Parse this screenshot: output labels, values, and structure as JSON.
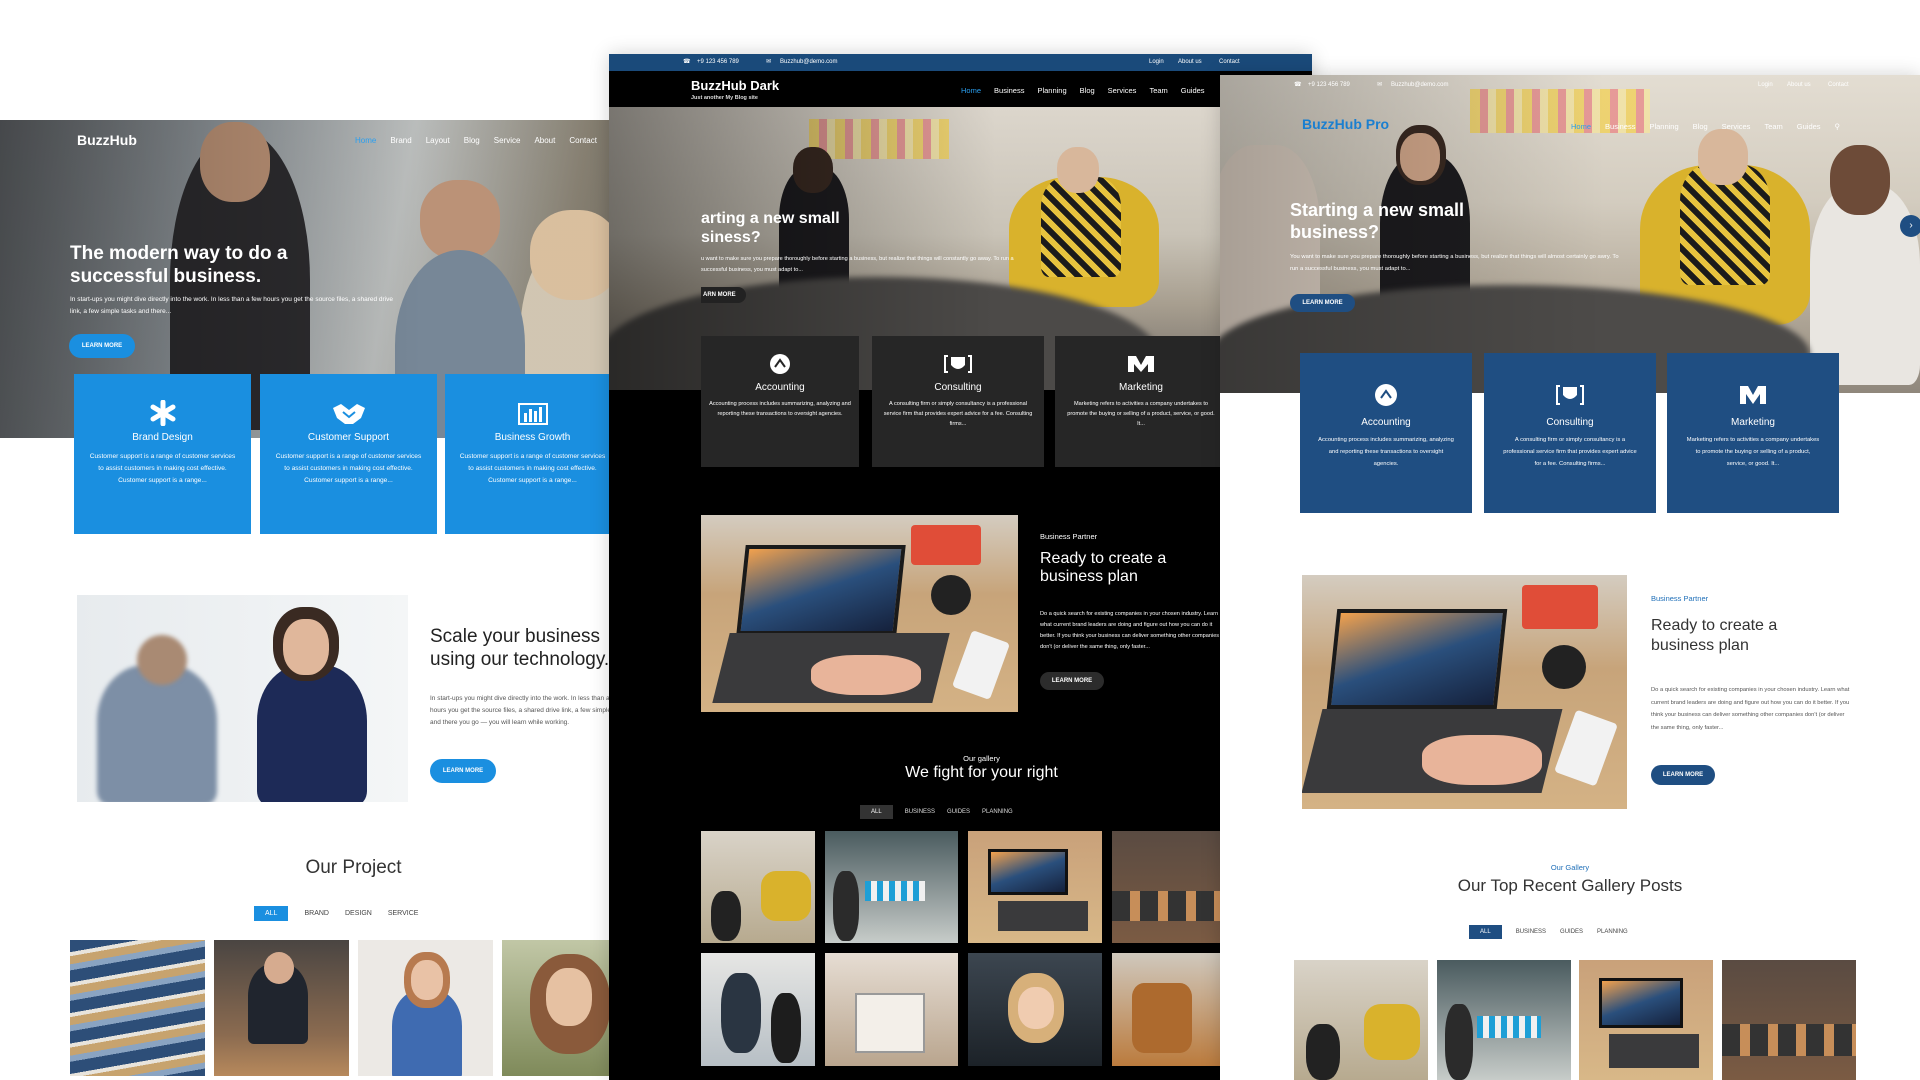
{
  "light": {
    "brand": "BuzzHub",
    "nav": [
      "Home",
      "Brand",
      "Layout",
      "Blog",
      "Service",
      "About",
      "Contact"
    ],
    "hero_title": "The modern way to do a successful business.",
    "hero_text": "In start-ups you might dive directly into the work. In less than a few hours you get the source files, a shared drive link, a few simple tasks and there...",
    "hero_button": "LEARN MORE",
    "cards": [
      {
        "title": "Brand Design",
        "text": "Customer support is a range of customer services to assist customers in making cost effective. Customer support is a range...",
        "icon": "asterisk-icon"
      },
      {
        "title": "Customer Support",
        "text": "Customer support is a range of customer services to assist customers in making cost effective. Customer support is a range...",
        "icon": "handshake-icon"
      },
      {
        "title": "Business Growth",
        "text": "Customer support is a range of customer services to assist customers in making cost effective. Customer support is a range...",
        "icon": "bar-chart-icon"
      }
    ],
    "about_title": "Scale your business using our technology.",
    "about_text": "In start-ups you might dive directly into the work. In less than a few hours you get the source files, a shared drive link, a few simple tasks and there you go — you will learn while working.",
    "about_button": "LEARN MORE",
    "project_title": "Our Project",
    "filters": [
      "ALL",
      "BRAND",
      "DESIGN",
      "SERVICE"
    ]
  },
  "dark": {
    "phone": "+9 123 456 789",
    "email": "Buzzhub@demo.com",
    "top_links": [
      "Login",
      "About us",
      "Contact"
    ],
    "brand": "BuzzHub Dark",
    "tagline": "Just another My Blog site",
    "nav": [
      "Home",
      "Business",
      "Planning",
      "Blog",
      "Services",
      "Team",
      "Guides"
    ],
    "hero_title": "arting a new small siness?",
    "hero_text": "u want to make sure you prepare thoroughly before starting a business, but realize that things will constantly go away. To run a successful business, you must adapt to...",
    "hero_button": "ARN MORE",
    "cards": [
      {
        "title": "Accounting",
        "text": "Accounting process includes summarizing, analyzing and reporting these transactions to oversight agencies.",
        "icon": "accounting-icon"
      },
      {
        "title": "Consulting",
        "text": "A consulting firm or simply consultancy is a professional service firm that provides expert advice for a fee. Consulting firms...",
        "icon": "consulting-icon"
      },
      {
        "title": "Marketing",
        "text": "Marketing refers to activities a company undertakes to promote the buying or selling of a product, service, or good. It...",
        "icon": "marketing-icon"
      }
    ],
    "partner_label": "Business Partner",
    "partner_title": "Ready to create a business plan",
    "partner_text": "Do a quick search for existing companies in your chosen industry. Learn what current brand leaders are doing and figure out how you can do it better. If you think your business can deliver something other companies don't (or deliver the same thing, only faster...",
    "partner_button": "LEARN MORE",
    "gallery_label": "Our gallery",
    "gallery_title": "We fight for your right",
    "filters": [
      "ALL",
      "BUSINESS",
      "GUIDES",
      "PLANNING"
    ]
  },
  "pro": {
    "phone": "+9 123 456 789",
    "email": "Buzzhub@demo.com",
    "top_links": [
      "Login",
      "About us",
      "Contact"
    ],
    "brand": "BuzzHub Pro",
    "nav": [
      "Home",
      "Business",
      "Planning",
      "Blog",
      "Services",
      "Team",
      "Guides"
    ],
    "hero_title": "Starting a new small business?",
    "hero_text": "You want to make sure you prepare thoroughly before starting a business, but realize that things will almost certainly go awry. To run a successful business, you must adapt to...",
    "hero_button": "LEARN MORE",
    "cards": [
      {
        "title": "Accounting",
        "text": "Accounting process includes summarizing, analyzing and reporting these transactions to oversight agencies.",
        "icon": "accounting-icon"
      },
      {
        "title": "Consulting",
        "text": "A consulting firm or simply consultancy is a professional service firm that provides expert advice for a fee. Consulting firms...",
        "icon": "consulting-icon"
      },
      {
        "title": "Marketing",
        "text": "Marketing refers to activities a company undertakes to promote the buying or selling of a product, service, or good. It...",
        "icon": "marketing-icon"
      }
    ],
    "partner_label": "Business Partner",
    "partner_title": "Ready to create a business plan",
    "partner_text": "Do a quick search for existing companies in your chosen industry. Learn what current brand leaders are doing and figure out how you can do it better. If you think your business can deliver something other companies don't (or deliver the same thing, only faster...",
    "partner_button": "LEARN MORE",
    "gallery_label": "Our Gallery",
    "gallery_title": "Our Top Recent Gallery Posts",
    "filters": [
      "ALL",
      "BUSINESS",
      "GUIDES",
      "PLANNING"
    ]
  },
  "colors": {
    "light_blue": "#1a8fe0",
    "dark_bg": "#000000",
    "dark_card": "#262626",
    "pro_blue": "#1f4e82",
    "top_bar": "#1a4a7a"
  }
}
